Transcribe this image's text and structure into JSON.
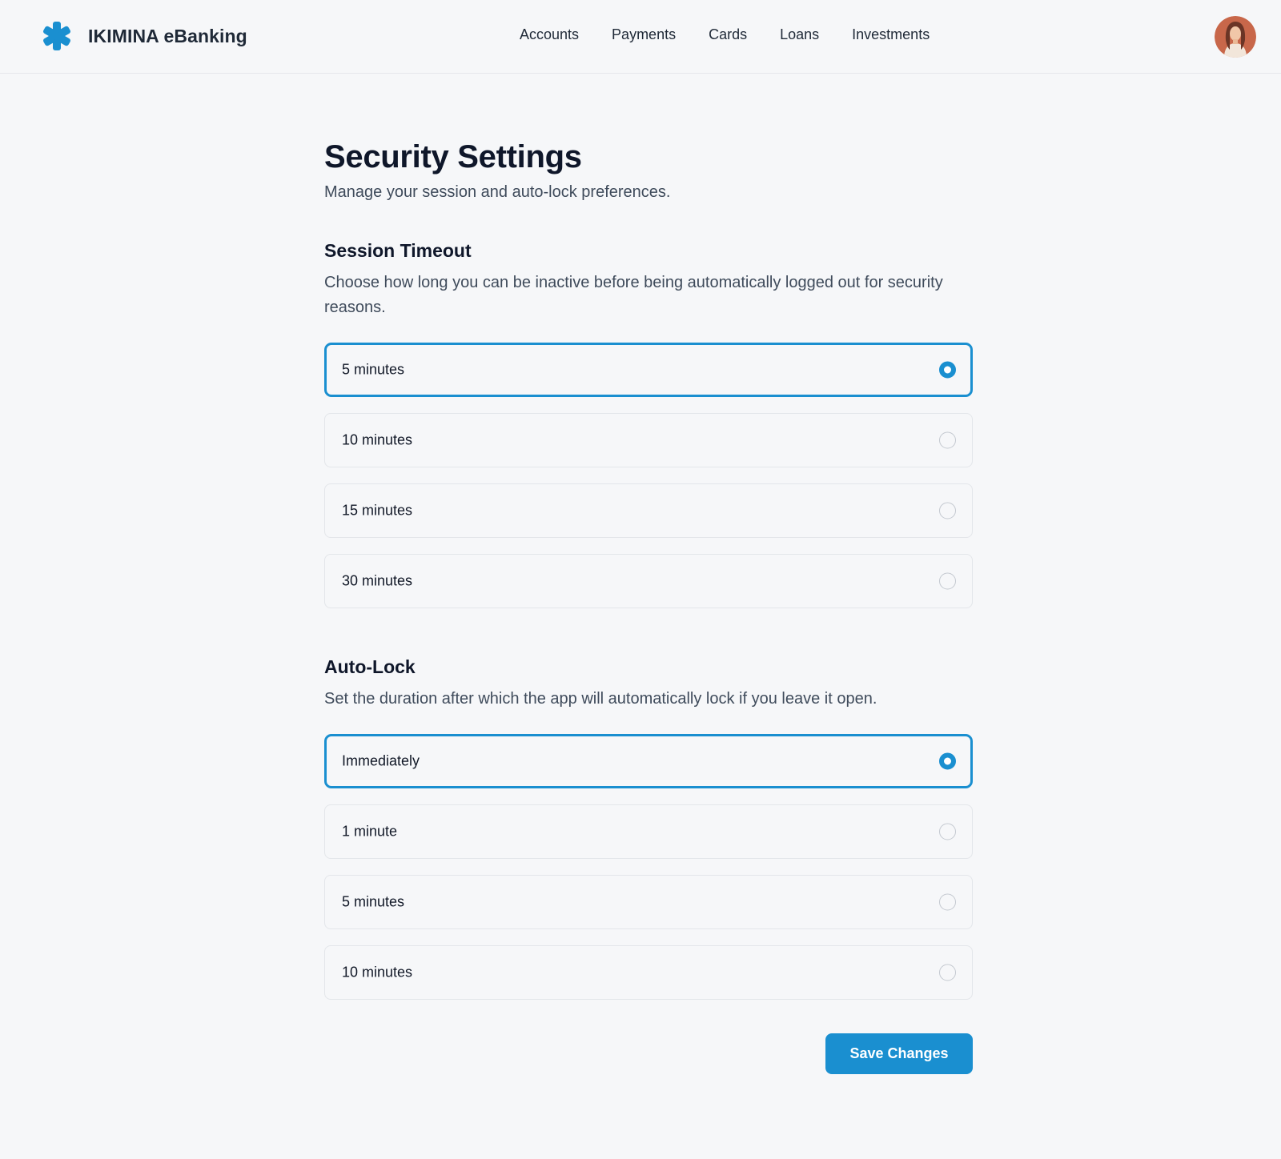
{
  "header": {
    "brand_name": "IKIMINA eBanking",
    "logo_icon": "asterisk-logo-icon",
    "nav": [
      {
        "label": "Accounts"
      },
      {
        "label": "Payments"
      },
      {
        "label": "Cards"
      },
      {
        "label": "Loans"
      },
      {
        "label": "Investments"
      }
    ],
    "avatar_icon": "user-avatar"
  },
  "page": {
    "title": "Security Settings",
    "subtitle": "Manage your session and auto-lock preferences."
  },
  "session_timeout": {
    "title": "Session Timeout",
    "description": "Choose how long you can be inactive before being automatically logged out for security reasons.",
    "options": [
      {
        "label": "5 minutes",
        "selected": true
      },
      {
        "label": "10 minutes",
        "selected": false
      },
      {
        "label": "15 minutes",
        "selected": false
      },
      {
        "label": "30 minutes",
        "selected": false
      }
    ]
  },
  "auto_lock": {
    "title": "Auto-Lock",
    "description": "Set the duration after which the app will automatically lock if you leave it open.",
    "options": [
      {
        "label": "Immediately",
        "selected": true
      },
      {
        "label": "1 minute",
        "selected": false
      },
      {
        "label": "5 minutes",
        "selected": false
      },
      {
        "label": "10 minutes",
        "selected": false
      }
    ]
  },
  "actions": {
    "save_label": "Save Changes"
  },
  "colors": {
    "accent": "#1a8fd0",
    "background": "#f6f7f9",
    "text_primary": "#0f172a",
    "text_secondary": "#3f4b5b",
    "border": "#e3e6ea"
  }
}
